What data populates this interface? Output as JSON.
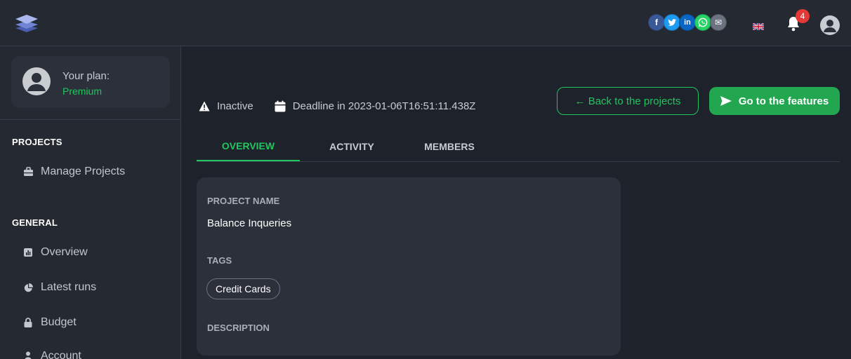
{
  "header": {
    "logo_icon": "layers-icon",
    "social": [
      {
        "name": "facebook-icon",
        "glyph": "f"
      },
      {
        "name": "twitter-icon",
        "glyph": "t"
      },
      {
        "name": "linkedin-icon",
        "glyph": "in"
      },
      {
        "name": "whatsapp-icon",
        "glyph": "w"
      },
      {
        "name": "email-icon",
        "glyph": "✉"
      }
    ],
    "notification_count": "4"
  },
  "sidebar": {
    "plan_label": "Your plan:",
    "plan_value": "Premium",
    "projects_title": "PROJECTS",
    "projects_items": [
      {
        "label": "Manage Projects",
        "icon": "briefcase-icon"
      }
    ],
    "general_title": "GENERAL",
    "general_items": [
      {
        "label": "Overview",
        "icon": "chart-icon"
      },
      {
        "label": "Latest runs",
        "icon": "pie-chart-icon"
      },
      {
        "label": "Budget",
        "icon": "lock-icon"
      },
      {
        "label": "Account",
        "icon": "user-icon"
      }
    ]
  },
  "main": {
    "status": "Inactive",
    "deadline": "Deadline in 2023-01-06T16:51:11.438Z",
    "back_button": "← Back to the projects",
    "go_button": "Go to the features",
    "tabs": [
      {
        "label": "OVERVIEW",
        "active": true
      },
      {
        "label": "ACTIVITY",
        "active": false
      },
      {
        "label": "MEMBERS",
        "active": false
      }
    ],
    "card": {
      "project_name_label": "PROJECT NAME",
      "project_name": "Balance Inqueries",
      "tags_label": "TAGS",
      "tags": [
        "Credit Cards"
      ],
      "description_label": "DESCRIPTION"
    }
  },
  "colors": {
    "accent": "#22c55e",
    "background": "#1e222b",
    "panel": "#242932",
    "card": "#2b303a"
  }
}
